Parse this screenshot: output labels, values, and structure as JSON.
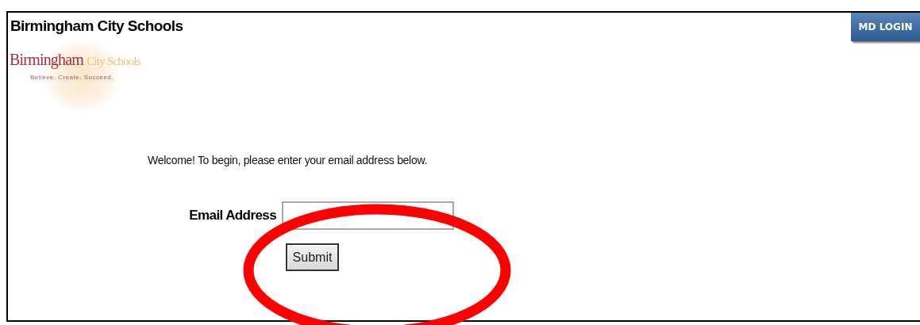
{
  "header": {
    "title": "Birmingham City Schools",
    "login_button": "MD LOGIN"
  },
  "logo": {
    "name_primary": "Birmingham",
    "name_secondary": "City Schools",
    "tagline": "Believe. Create. Succeed."
  },
  "welcome": "Welcome! To begin, please enter your email address below.",
  "form": {
    "email_label": "Email Address",
    "submit": "Submit"
  }
}
